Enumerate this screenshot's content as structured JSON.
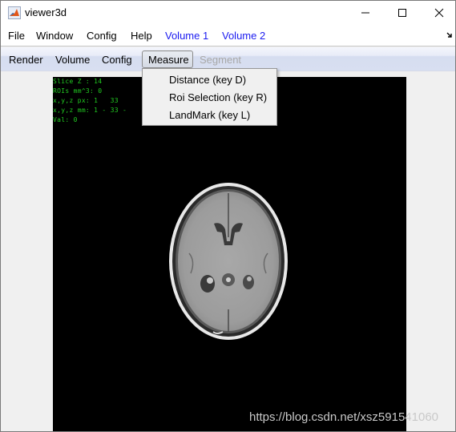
{
  "window": {
    "title": "viewer3d",
    "icon": "matlab-icon",
    "controls": [
      "minimize",
      "maximize",
      "close"
    ]
  },
  "menubar": {
    "items": [
      {
        "label": "File"
      },
      {
        "label": "Window"
      },
      {
        "label": "Config"
      },
      {
        "label": "Help"
      },
      {
        "label": "Volume 1",
        "color": "#1a1af0"
      },
      {
        "label": "Volume 2",
        "color": "#1a1af0"
      }
    ],
    "undock_icon": "undock-arrow-icon"
  },
  "toolbar": {
    "items": [
      {
        "label": "Render",
        "state": "normal"
      },
      {
        "label": "Volume",
        "state": "normal"
      },
      {
        "label": "Config",
        "state": "normal"
      },
      {
        "label": "Measure",
        "state": "active"
      },
      {
        "label": "Segment",
        "state": "disabled"
      }
    ]
  },
  "measure_menu": {
    "items": [
      {
        "label": "Distance (key D)"
      },
      {
        "label": "Roi Selection (key R)"
      },
      {
        "label": "LandMark (key L)"
      }
    ]
  },
  "viewer": {
    "overlay": [
      "Slice Z : 14",
      "ROIs mm^3: 0",
      "x,y,z px: 1   33",
      "x,y,z mm: 1 - 33 -",
      "Val: 0"
    ],
    "overlay_color": "#22cc22",
    "image": "axial MRI brain slice"
  },
  "watermark": "https://blog.csdn.net/xsz591541060"
}
